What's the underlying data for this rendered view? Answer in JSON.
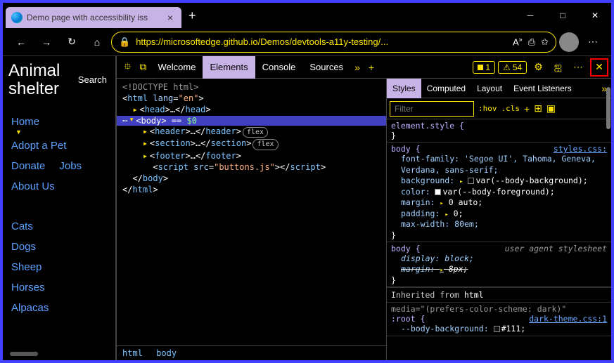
{
  "browser": {
    "tab_title": "Demo page with accessibility iss",
    "url": "https://microsoftedge.github.io/Demos/devtools-a11y-testing/...",
    "reader_label": "A"
  },
  "page": {
    "logo_line1": "Animal",
    "logo_line2": "shelter",
    "search_label": "Search",
    "nav": {
      "home": "Home",
      "adopt": "Adopt a Pet",
      "donate": "Donate",
      "jobs": "Jobs",
      "about": "About Us",
      "cats": "Cats",
      "dogs": "Dogs",
      "sheep": "Sheep",
      "horses": "Horses",
      "alpacas": "Alpacas"
    }
  },
  "devtools": {
    "tabs": {
      "welcome": "Welcome",
      "elements": "Elements",
      "console": "Console",
      "sources": "Sources"
    },
    "errors": "1",
    "warnings": "54",
    "dom": {
      "doctype": "<!DOCTYPE html>",
      "html_open": "<html lang=\"en\">",
      "head": "<head>…</head>",
      "body_sel": "<body> == $0",
      "header": "<header>…</header>",
      "section": "<section>…</section>",
      "footer": "<footer>…</footer>",
      "script": "<script src=\"buttons.js\"></scr",
      "script2": "ipt>",
      "body_close": "</body>",
      "html_close": "</html>",
      "flex_pill": "flex"
    },
    "breadcrumb": {
      "html": "html",
      "body": "body"
    },
    "styles": {
      "tabs": {
        "styles": "Styles",
        "computed": "Computed",
        "layout": "Layout",
        "events": "Event Listeners"
      },
      "filter_placeholder": "Filter",
      "hov": ":hov",
      "cls": ".cls",
      "r1": {
        "sel": "element.style {"
      },
      "r2": {
        "sel": "body {",
        "link": "styles.css:",
        "font": "font-family: 'Segoe UI', Tahoma, Geneva, Verdana, sans-serif;",
        "bg": "background: ",
        "bg2": "var(--body-background);",
        "color": "color: ",
        "color2": "var(--body-foreground);",
        "margin": "margin: ",
        "margin2": "0 auto;",
        "padding": "padding: ",
        "padding2": "0;",
        "maxw": "max-width: 80em;"
      },
      "r3": {
        "sel": "body {",
        "ua": "user agent stylesheet",
        "display": "display: block;",
        "margin": "margin: ",
        "margin2": "8px;"
      },
      "inherit": "Inherited from ",
      "inherit_el": "html",
      "r4": {
        "media": "media=\"(prefers-color-scheme: dark)\"",
        "sel": ":root {",
        "link": "dark-theme.css:1",
        "var": "--body-background: ",
        "var2": "#111;"
      }
    }
  }
}
